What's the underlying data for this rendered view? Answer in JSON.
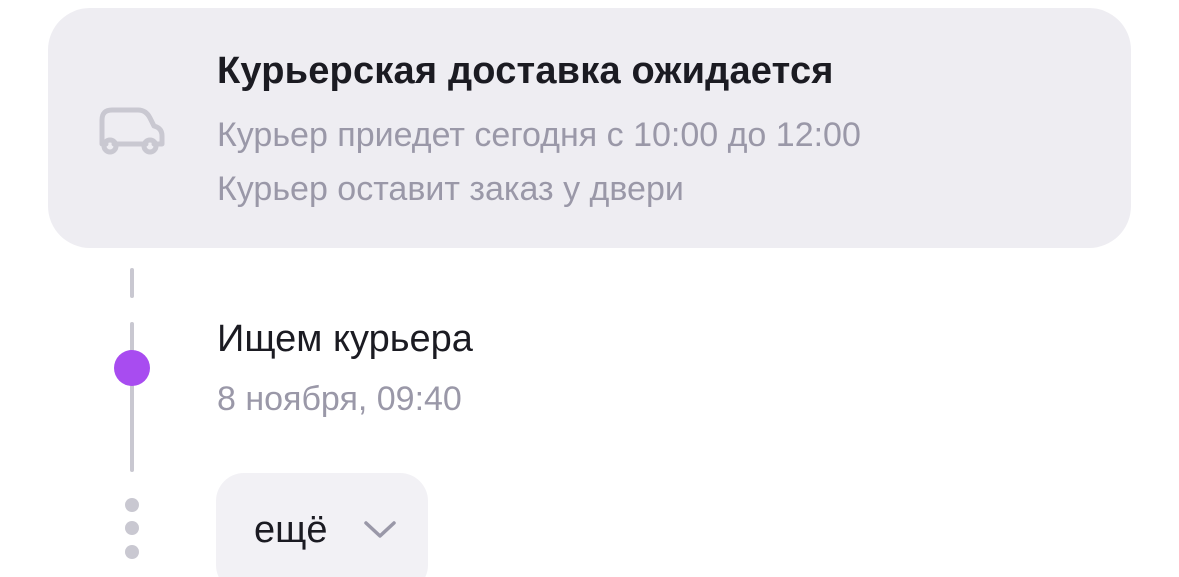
{
  "delivery_card": {
    "icon": "car-icon",
    "title": "Курьерская доставка ожидается",
    "lines": [
      "Курьер приедет сегодня с 10:00 до 12:00",
      "Курьер оставит заказ у двери"
    ]
  },
  "timeline": {
    "event": {
      "title": "Ищем курьера",
      "time": "8 ноября, 09:40",
      "dot_color": "#a84cf0"
    },
    "more_button": {
      "label": "ещё",
      "icon": "chevron-down-icon"
    }
  },
  "colors": {
    "card_background": "#eeedf2",
    "primary_text": "#1b1b22",
    "secondary_text": "#9a98a8",
    "timeline_line": "#c9c8d1",
    "accent": "#a84cf0"
  }
}
